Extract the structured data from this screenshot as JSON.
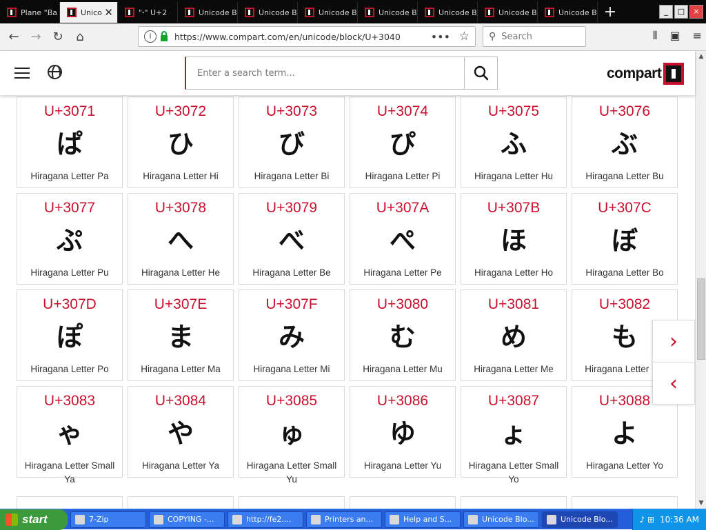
{
  "browser": {
    "tabs": [
      {
        "label": "Plane \"Ba",
        "active": false
      },
      {
        "label": "Unico",
        "active": true
      },
      {
        "label": "\"ꞏ\" U+2",
        "active": false
      },
      {
        "label": "Unicode B",
        "active": false
      },
      {
        "label": "Unicode B",
        "active": false
      },
      {
        "label": "Unicode B",
        "active": false
      },
      {
        "label": "Unicode B",
        "active": false
      },
      {
        "label": "Unicode B",
        "active": false
      },
      {
        "label": "Unicode B",
        "active": false
      },
      {
        "label": "Unicode B",
        "active": false
      }
    ],
    "new_tab": "+",
    "url": "https://www.compart.com/en/unicode/block/U+3040",
    "search_placeholder": "Search"
  },
  "header": {
    "search_placeholder": "Enter a search term...",
    "logo_text": "compart"
  },
  "cards": [
    {
      "code": "U+3071",
      "glyph": "ぱ",
      "name": "Hiragana Letter Pa"
    },
    {
      "code": "U+3072",
      "glyph": "ひ",
      "name": "Hiragana Letter Hi"
    },
    {
      "code": "U+3073",
      "glyph": "び",
      "name": "Hiragana Letter Bi"
    },
    {
      "code": "U+3074",
      "glyph": "ぴ",
      "name": "Hiragana Letter Pi"
    },
    {
      "code": "U+3075",
      "glyph": "ふ",
      "name": "Hiragana Letter Hu"
    },
    {
      "code": "U+3076",
      "glyph": "ぶ",
      "name": "Hiragana Letter Bu"
    },
    {
      "code": "U+3077",
      "glyph": "ぷ",
      "name": "Hiragana Letter Pu"
    },
    {
      "code": "U+3078",
      "glyph": "へ",
      "name": "Hiragana Letter He"
    },
    {
      "code": "U+3079",
      "glyph": "べ",
      "name": "Hiragana Letter Be"
    },
    {
      "code": "U+307A",
      "glyph": "ぺ",
      "name": "Hiragana Letter Pe"
    },
    {
      "code": "U+307B",
      "glyph": "ほ",
      "name": "Hiragana Letter Ho"
    },
    {
      "code": "U+307C",
      "glyph": "ぼ",
      "name": "Hiragana Letter Bo"
    },
    {
      "code": "U+307D",
      "glyph": "ぽ",
      "name": "Hiragana Letter Po"
    },
    {
      "code": "U+307E",
      "glyph": "ま",
      "name": "Hiragana Letter Ma"
    },
    {
      "code": "U+307F",
      "glyph": "み",
      "name": "Hiragana Letter Mi"
    },
    {
      "code": "U+3080",
      "glyph": "む",
      "name": "Hiragana Letter Mu"
    },
    {
      "code": "U+3081",
      "glyph": "め",
      "name": "Hiragana Letter Me"
    },
    {
      "code": "U+3082",
      "glyph": "も",
      "name": "Hiragana Letter Mo"
    },
    {
      "code": "U+3083",
      "glyph": "ゃ",
      "name": "Hiragana Letter Small Ya"
    },
    {
      "code": "U+3084",
      "glyph": "や",
      "name": "Hiragana Letter Ya"
    },
    {
      "code": "U+3085",
      "glyph": "ゅ",
      "name": "Hiragana Letter Small Yu"
    },
    {
      "code": "U+3086",
      "glyph": "ゆ",
      "name": "Hiragana Letter Yu"
    },
    {
      "code": "U+3087",
      "glyph": "ょ",
      "name": "Hiragana Letter Small Yo"
    },
    {
      "code": "U+3088",
      "glyph": "よ",
      "name": "Hiragana Letter Yo"
    }
  ],
  "nav_arrows": {
    "next": "›",
    "prev": "‹"
  },
  "taskbar": {
    "start": "start",
    "items": [
      {
        "label": "7-Zip",
        "active": false
      },
      {
        "label": "COPYING -...",
        "active": false
      },
      {
        "label": "http://fe2....",
        "active": false
      },
      {
        "label": "Printers an...",
        "active": false
      },
      {
        "label": "Help and S...",
        "active": false
      },
      {
        "label": "Unicode Blo...",
        "active": false
      },
      {
        "label": "Unicode Blo...",
        "active": true
      }
    ],
    "clock": "10:36 AM"
  },
  "colors": {
    "accent": "#c8102e",
    "taskbar": "#245edb",
    "start": "#3c9a3c"
  }
}
